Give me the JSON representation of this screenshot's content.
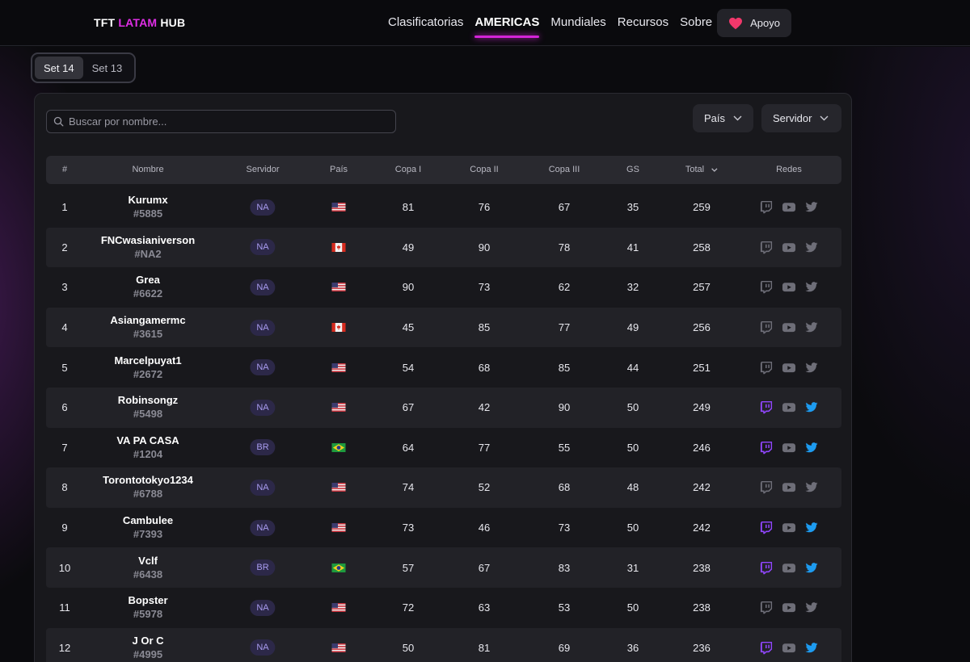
{
  "header": {
    "brand_left": "TFT",
    "brand_accent": "LATAM",
    "brand_right": "HUB",
    "nav": [
      "Clasificatorias",
      "AMERICAS",
      "Mundiales",
      "Recursos",
      "Sobre"
    ],
    "active_nav": "AMERICAS",
    "support_label": "Apoyo"
  },
  "set_tabs": {
    "items": [
      "Set 14",
      "Set 13"
    ],
    "active": "Set 14"
  },
  "search": {
    "placeholder": "Buscar por nombre..."
  },
  "filters": {
    "country_label": "País",
    "server_label": "Servidor"
  },
  "table": {
    "columns": [
      "#",
      "Nombre",
      "Servidor",
      "País",
      "Copa I",
      "Copa II",
      "Copa III",
      "GS",
      "Total",
      "Redes"
    ],
    "sorted_by": "Total",
    "rows": [
      {
        "rank": "1",
        "name": "Kurumx",
        "tag": "#5885",
        "server": "NA",
        "country": "us",
        "c1": "81",
        "c2": "76",
        "c3": "67",
        "gs": "35",
        "total": "259",
        "social_active": false
      },
      {
        "rank": "2",
        "name": "FNCwasianiverson",
        "tag": "#NA2",
        "server": "NA",
        "country": "ca",
        "c1": "49",
        "c2": "90",
        "c3": "78",
        "gs": "41",
        "total": "258",
        "social_active": false
      },
      {
        "rank": "3",
        "name": "Grea",
        "tag": "#6622",
        "server": "NA",
        "country": "us",
        "c1": "90",
        "c2": "73",
        "c3": "62",
        "gs": "32",
        "total": "257",
        "social_active": false
      },
      {
        "rank": "4",
        "name": "Asiangamermc",
        "tag": "#3615",
        "server": "NA",
        "country": "ca",
        "c1": "45",
        "c2": "85",
        "c3": "77",
        "gs": "49",
        "total": "256",
        "social_active": false
      },
      {
        "rank": "5",
        "name": "Marcelpuyat1",
        "tag": "#2672",
        "server": "NA",
        "country": "us",
        "c1": "54",
        "c2": "68",
        "c3": "85",
        "gs": "44",
        "total": "251",
        "social_active": false
      },
      {
        "rank": "6",
        "name": "Robinsongz",
        "tag": "#5498",
        "server": "NA",
        "country": "us",
        "c1": "67",
        "c2": "42",
        "c3": "90",
        "gs": "50",
        "total": "249",
        "social_active": true
      },
      {
        "rank": "7",
        "name": "VA PA CASA",
        "tag": "#1204",
        "server": "BR",
        "country": "br",
        "c1": "64",
        "c2": "77",
        "c3": "55",
        "gs": "50",
        "total": "246",
        "social_active": true
      },
      {
        "rank": "8",
        "name": "Torontotokyo1234",
        "tag": "#6788",
        "server": "NA",
        "country": "us",
        "c1": "74",
        "c2": "52",
        "c3": "68",
        "gs": "48",
        "total": "242",
        "social_active": false
      },
      {
        "rank": "9",
        "name": "Cambulee",
        "tag": "#7393",
        "server": "NA",
        "country": "us",
        "c1": "73",
        "c2": "46",
        "c3": "73",
        "gs": "50",
        "total": "242",
        "social_active": true
      },
      {
        "rank": "10",
        "name": "Vclf",
        "tag": "#6438",
        "server": "BR",
        "country": "br",
        "c1": "57",
        "c2": "67",
        "c3": "83",
        "gs": "31",
        "total": "238",
        "social_active": true
      },
      {
        "rank": "11",
        "name": "Bopster",
        "tag": "#5978",
        "server": "NA",
        "country": "us",
        "c1": "72",
        "c2": "63",
        "c3": "53",
        "gs": "50",
        "total": "238",
        "social_active": false
      },
      {
        "rank": "12",
        "name": "J Or C",
        "tag": "#4995",
        "server": "NA",
        "country": "us",
        "c1": "50",
        "c2": "81",
        "c3": "69",
        "gs": "36",
        "total": "236",
        "social_active": true
      }
    ]
  },
  "colors": {
    "accent": "#d424d8",
    "heart": "#f0386b",
    "twitch_active": "#9146ff",
    "twitter_active": "#1d9bf0",
    "social_inactive": "#6e6e78",
    "server_badge_text": "#a99cf0"
  },
  "icons": {
    "support": "heart-icon",
    "search": "search-icon",
    "dropdown": "chevron-down-icon",
    "sort": "chevron-down-icon",
    "socials": [
      "twitch-icon",
      "youtube-icon",
      "twitter-icon"
    ]
  }
}
